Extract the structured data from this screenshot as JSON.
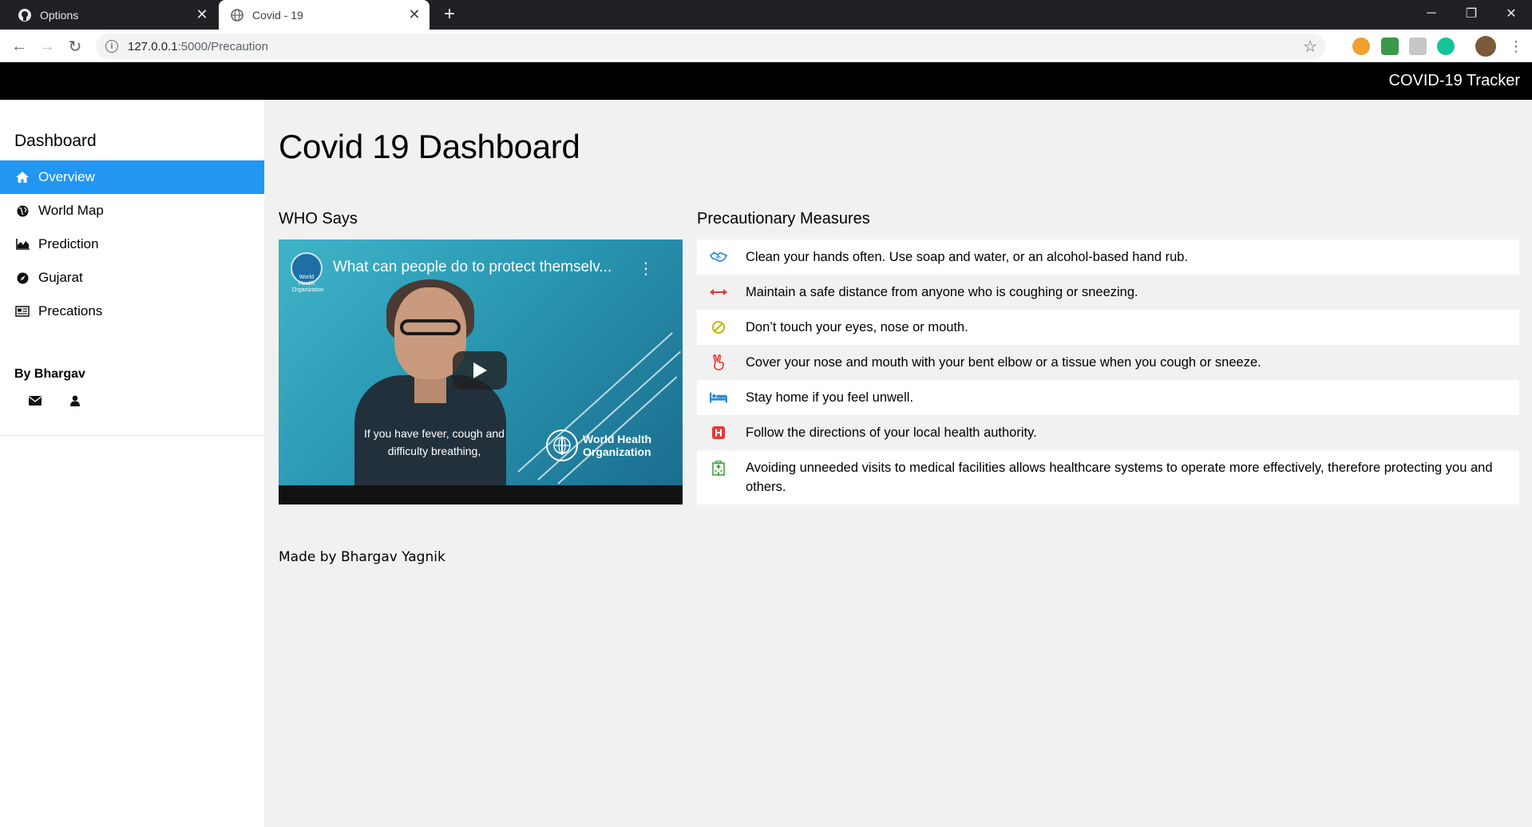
{
  "browser": {
    "tabs": [
      {
        "title": "Options",
        "active": false,
        "icon": "github-icon"
      },
      {
        "title": "Covid - 19",
        "active": true,
        "icon": "globe-icon"
      }
    ],
    "close_glyph": "✕",
    "new_tab_glyph": "+",
    "url_host": "127.0.0.1",
    "url_path": ":5000/Precaution",
    "window_controls": {
      "minimize": "─",
      "restore": "❐",
      "close": "✕"
    },
    "nav": {
      "back": "←",
      "forward": "→",
      "reload": "↻"
    },
    "star": "☆",
    "info": "i"
  },
  "header": {
    "brand": "COVID-19 Tracker"
  },
  "sidebar": {
    "heading": "Dashboard",
    "items": [
      {
        "label": "Overview",
        "icon": "home-icon",
        "active": true
      },
      {
        "label": "World Map",
        "icon": "globe-icon",
        "active": false
      },
      {
        "label": "Prediction",
        "icon": "area-chart-icon",
        "active": false
      },
      {
        "label": "Gujarat",
        "icon": "compass-icon",
        "active": false
      },
      {
        "label": "Precations",
        "icon": "newspaper-icon",
        "active": false
      }
    ],
    "author": "By Bhargav",
    "author_icons": [
      "envelope-icon",
      "user-icon"
    ]
  },
  "main": {
    "title": "Covid 19 Dashboard",
    "video_section_title": "WHO Says",
    "measures_section_title": "Precautionary Measures",
    "video": {
      "title": "What can people do to protect themselv...",
      "caption": "If you have fever, cough and difficulty breathing,",
      "badge": "World Health Organization",
      "logo_text_line1": "World Health",
      "logo_text_line2": "Organization",
      "menu": "⋮"
    },
    "measures": [
      {
        "text": "Clean your hands often. Use soap and water, or an alcohol-based hand rub.",
        "icon": "handshake-icon",
        "color": "#2a8ad6"
      },
      {
        "text": "Maintain a safe distance from anyone who is coughing or sneezing.",
        "icon": "arrows-horizontal-icon",
        "color": "#e53935"
      },
      {
        "text": "Don’t touch your eyes, nose or mouth.",
        "icon": "ban-icon",
        "color": "#c9b400"
      },
      {
        "text": "Cover your nose and mouth with your bent elbow or a tissue when you cough or sneeze.",
        "icon": "peace-hand-icon",
        "color": "#e53935"
      },
      {
        "text": "Stay home if you feel unwell.",
        "icon": "bed-icon",
        "color": "#2a8ad6"
      },
      {
        "text": "Follow the directions of your local health authority.",
        "icon": "hospital-h-icon",
        "color": "#e53935"
      },
      {
        "text": "Avoiding unneeded visits to medical facilities allows healthcare systems to operate more effectively, therefore protecting you and others.",
        "icon": "hospital-building-icon",
        "color": "#43a047"
      }
    ]
  },
  "footer": {
    "text": "Made by Bhargav Yagnik"
  }
}
